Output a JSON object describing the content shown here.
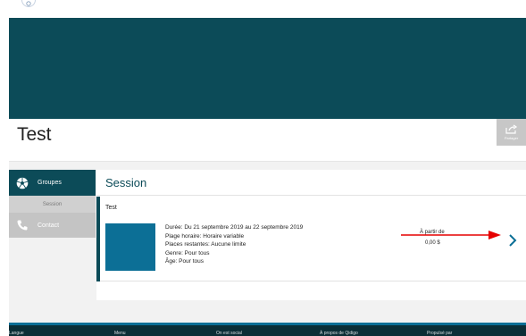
{
  "page": {
    "title": "Test"
  },
  "share": {
    "label": "Partager",
    "icon": "share-icon"
  },
  "sidebar": {
    "groupes_label": "Groupes",
    "session_label": "Session",
    "contact_label": "Contact",
    "groupes_icon": "soccer-ball-icon",
    "contact_icon": "phone-icon"
  },
  "main": {
    "heading": "Session",
    "card": {
      "name": "Test",
      "duree": "Durée: Du 21 septembre 2019 au 22 septembre 2019",
      "plage": "Plage horaire: Horaire variable",
      "places": "Places restantes: Aucune limite",
      "genre": "Genre: Pour tous",
      "age": "Âge: Pour tous",
      "price_from": "À partir de",
      "price": "0,00 $"
    }
  },
  "footer": {
    "items": [
      "Langue",
      "Menu",
      "On est social",
      "À propos de Qidigo",
      "Propulsé par"
    ]
  },
  "colors": {
    "brand": "#0c4b58",
    "accent": "#0c6f96",
    "annotation_arrow": "#e60000"
  }
}
